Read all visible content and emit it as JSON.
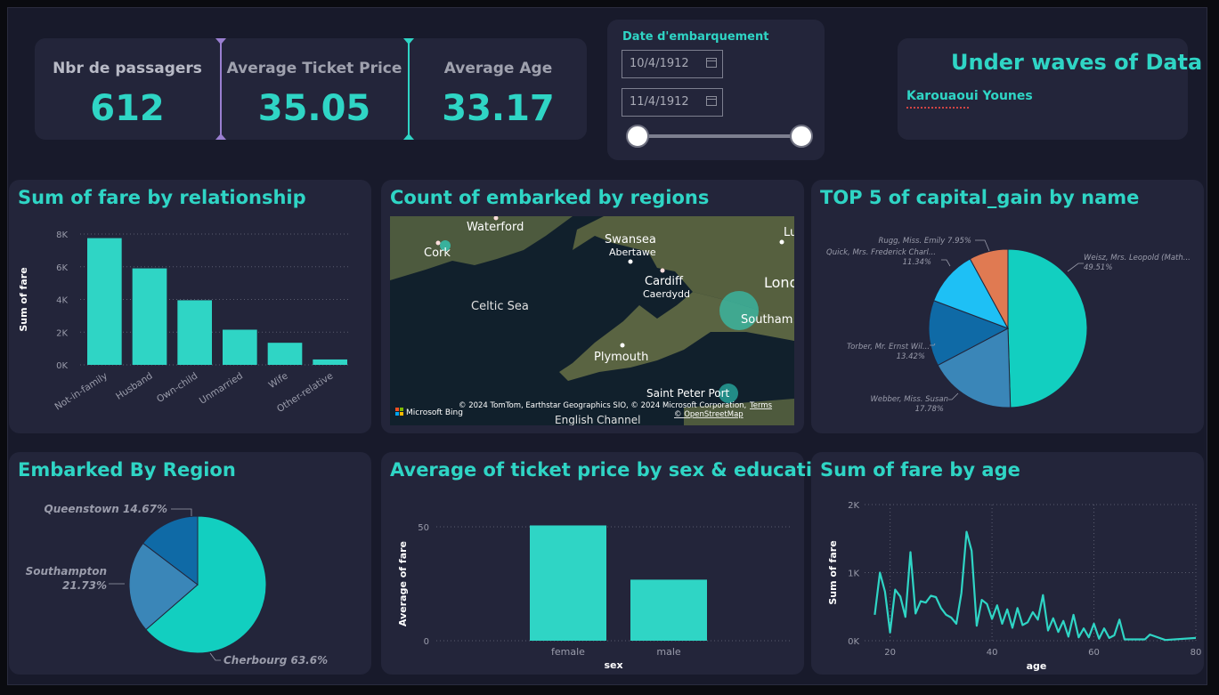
{
  "kpis": [
    {
      "label": "Nbr de passagers",
      "value": "612"
    },
    {
      "label": "Average Ticket Price",
      "value": "35.05"
    },
    {
      "label": "Average Age",
      "value": "33.17"
    }
  ],
  "date_filter": {
    "title": "Date d'embarquement",
    "start": "10/4/1912",
    "end": "11/4/1912"
  },
  "branding": {
    "title": "Under waves of Data",
    "author": "Karouaoui Younes"
  },
  "colors": {
    "accent": "#2fd5c5",
    "card": "#23253a",
    "background": "#181a2b"
  },
  "fare_by_relationship": {
    "title": "Sum of fare by relationship",
    "ylabel": "Sum of fare",
    "yticks": [
      "0K",
      "2K",
      "4K",
      "6K",
      "8K"
    ],
    "chart_data": {
      "type": "bar",
      "categories": [
        "Not-in-family",
        "Husband",
        "Own-child",
        "Unmarried",
        "Wife",
        "Other-relative"
      ],
      "values": [
        7750,
        5900,
        3950,
        2150,
        1350,
        330
      ],
      "ylim": [
        0,
        8000
      ],
      "ylabel": "Sum of fare",
      "xlabel": ""
    }
  },
  "map": {
    "title": "Count of embarked by regions",
    "places": [
      "Waterford",
      "Cork",
      "Swansea",
      "Abertawe",
      "Cardiff",
      "Caerdydd",
      "Celtic Sea",
      "Lond",
      "Southam",
      "Plymouth",
      "Saint Peter Port",
      "English Channel",
      "Lu"
    ],
    "attribution": "© 2024 TomTom, Earthstar Geographics SIO, © 2024 Microsoft Corporation,",
    "osm": "© OpenStreetMap",
    "terms": "Terms",
    "logo": "Microsoft Bing"
  },
  "capital_gain": {
    "title": "TOP 5 of capital_gain by name",
    "chart_data": {
      "type": "pie",
      "labels": [
        "Weisz, Mrs. Leopold (Math...",
        "Webber, Miss. Susan",
        "Torber, Mr. Ernst Wil...",
        "Quick, Mrs. Frederick Charl...",
        "Rugg, Miss. Emily"
      ],
      "values": [
        49.51,
        17.78,
        13.42,
        11.34,
        7.95
      ],
      "value_labels": [
        "49.51%",
        "17.78%",
        "13.42%",
        "11.34%",
        "7.95%"
      ],
      "colors": [
        "#12cfc0",
        "#3a86b8",
        "#0f6aa6",
        "#1ec0f5",
        "#e07a52"
      ]
    }
  },
  "embarked_region": {
    "title": "Embarked By Region",
    "chart_data": {
      "type": "pie",
      "labels": [
        "Cherbourg",
        "Southampton",
        "Queenstown"
      ],
      "values": [
        63.6,
        21.73,
        14.67
      ],
      "display": [
        "Cherbourg 63.6%",
        "Southampton",
        "21.73%",
        "Queenstown 14.67%"
      ],
      "colors": [
        "#12cfc0",
        "#3a86b8",
        "#0f6aa6"
      ]
    }
  },
  "ticket_by_sex": {
    "title": "Average of ticket price by sex & education",
    "ylabel": "Average of fare",
    "xlabel": "sex",
    "yticks": [
      "0",
      "50"
    ],
    "chart_data": {
      "type": "bar",
      "categories": [
        "female",
        "male"
      ],
      "values": [
        50.6,
        26.8
      ],
      "ylim": [
        0,
        50
      ],
      "xlabel": "sex",
      "ylabel": "Average of fare"
    }
  },
  "fare_by_age": {
    "title": "Sum of fare by age",
    "ylabel": "Sum of fare",
    "xlabel": "age",
    "yticks": [
      "0K",
      "1K",
      "2K"
    ],
    "xticks": [
      "20",
      "40",
      "60",
      "80"
    ],
    "chart_data": {
      "type": "line",
      "x": [
        17,
        18,
        19,
        20,
        21,
        22,
        23,
        24,
        25,
        26,
        27,
        28,
        29,
        30,
        31,
        32,
        33,
        34,
        35,
        36,
        37,
        38,
        39,
        40,
        41,
        42,
        43,
        44,
        45,
        46,
        47,
        48,
        49,
        50,
        51,
        52,
        53,
        54,
        55,
        56,
        57,
        58,
        59,
        60,
        61,
        62,
        63,
        64,
        65,
        66,
        70,
        71,
        74,
        80
      ],
      "y": [
        380,
        1000,
        720,
        120,
        750,
        650,
        350,
        1300,
        400,
        580,
        560,
        660,
        640,
        480,
        380,
        340,
        250,
        700,
        1600,
        1320,
        220,
        600,
        540,
        320,
        520,
        250,
        460,
        190,
        480,
        230,
        270,
        420,
        310,
        670,
        150,
        330,
        130,
        290,
        60,
        380,
        50,
        180,
        50,
        250,
        30,
        180,
        40,
        80,
        310,
        20,
        20,
        90,
        10,
        40
      ],
      "xlim": [
        15,
        80
      ],
      "ylim": [
        0,
        2000
      ],
      "xlabel": "age",
      "ylabel": "Sum of fare"
    }
  }
}
